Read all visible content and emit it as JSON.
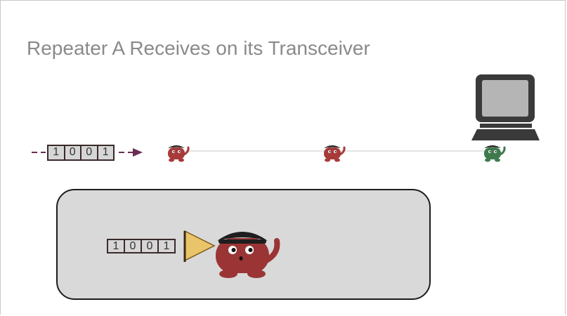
{
  "title": "Repeater A Receives on its Transceiver",
  "signal": {
    "bits": [
      "1",
      "0",
      "0",
      "1"
    ],
    "arrow_color": "#6b2d52"
  },
  "nodes": [
    {
      "id": "repeater-a",
      "color": "#a83a3a"
    },
    {
      "id": "repeater-b",
      "color": "#a83a3a"
    },
    {
      "id": "destination",
      "color": "#3f7a4f"
    }
  ],
  "zoom": {
    "bits": [
      "1",
      "0",
      "0",
      "1"
    ],
    "transceiver_color": "#e9c46a",
    "creature_color": "#9b3535"
  },
  "icons": [
    "computer-icon",
    "repeater-creature-icon",
    "transceiver-cone-icon"
  ]
}
